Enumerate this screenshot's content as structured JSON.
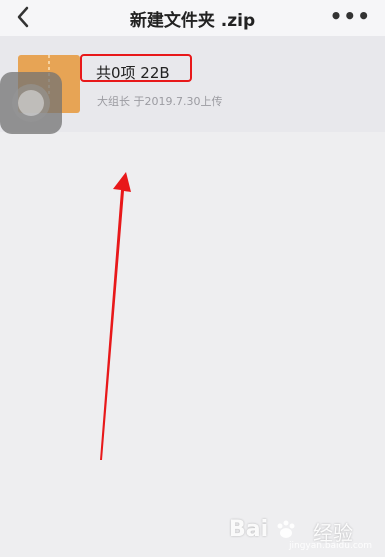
{
  "header": {
    "title": "新建文件夹 .zip",
    "back_icon": "chevron-left-icon",
    "more_icon": "more-dots-icon",
    "more_label": "•••"
  },
  "file": {
    "icon": "zip-file-icon",
    "name": "共0项 22B",
    "meta": "大组长 于2019.7.30上传"
  },
  "annotation": {
    "highlight_color": "#e8181a",
    "arrow_color": "#e8181a"
  },
  "watermark": {
    "brand": "Bai",
    "product": "经验",
    "url": "jingyan.baidu.com"
  }
}
